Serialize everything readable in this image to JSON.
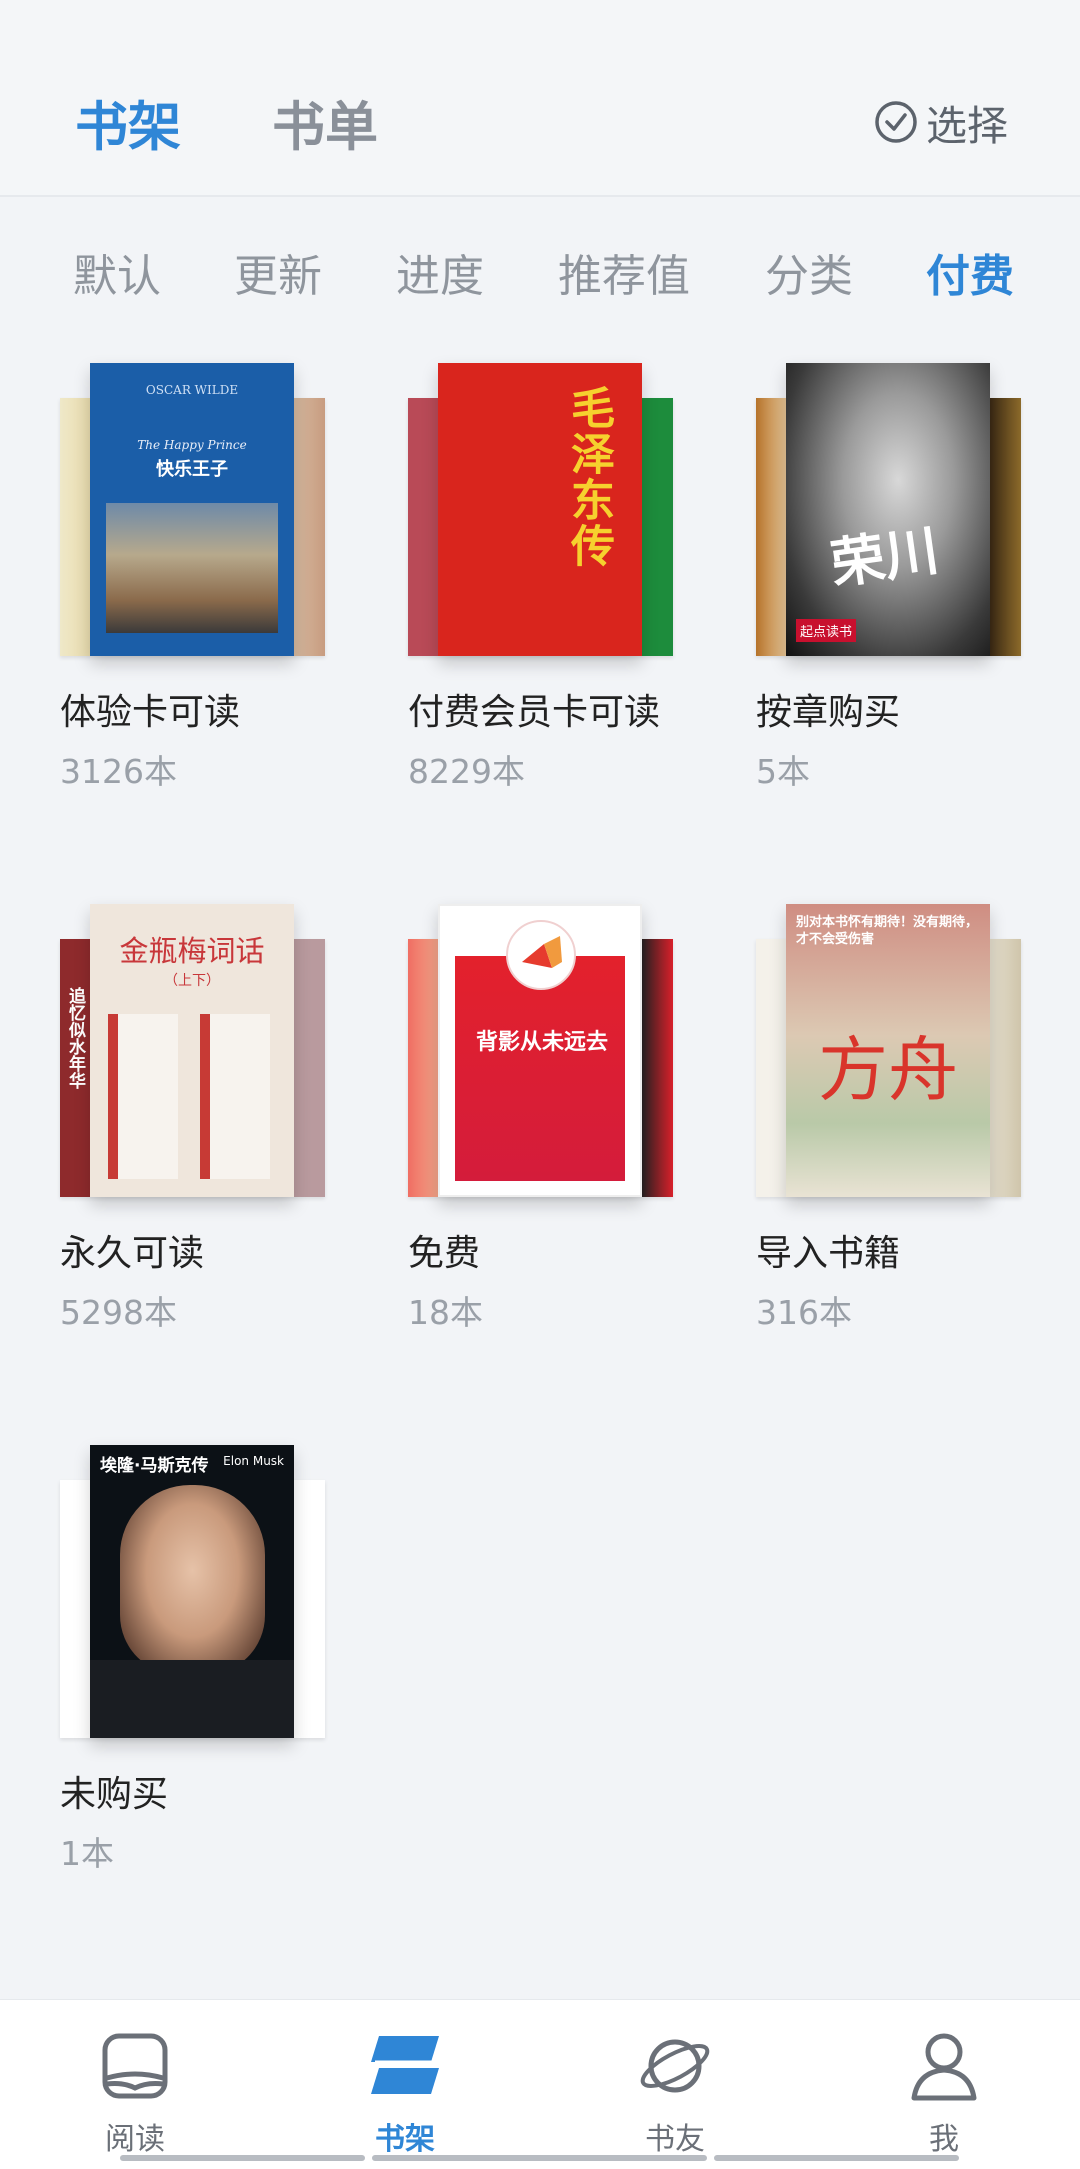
{
  "header": {
    "tabs": [
      {
        "label": "书架",
        "active": true
      },
      {
        "label": "书单",
        "active": false
      }
    ],
    "select_label": "选择"
  },
  "sort_options": [
    {
      "label": "默认",
      "active": false
    },
    {
      "label": "更新",
      "active": false
    },
    {
      "label": "进度",
      "active": false
    },
    {
      "label": "推荐值",
      "active": false
    },
    {
      "label": "分类",
      "active": false
    },
    {
      "label": "付费",
      "active": true
    }
  ],
  "groups": [
    {
      "title": "体验卡可读",
      "count": "3126本",
      "front_cover": {
        "title": "快乐王子",
        "subtitle": "The Happy Prince",
        "author": "OSCAR WILDE"
      }
    },
    {
      "title": "付费会员卡可读",
      "count": "8229本",
      "front_cover": {
        "title": "毛泽东传"
      }
    },
    {
      "title": "按章购买",
      "count": "5本",
      "front_cover": {
        "title": "荣川",
        "publisher": "起点读书"
      }
    },
    {
      "title": "永久可读",
      "count": "5298本",
      "front_cover": {
        "title": "金瓶梅词话",
        "subtitle": "（上下）"
      },
      "back_cover": {
        "title": "追忆似水年华"
      }
    },
    {
      "title": "免费",
      "count": "18本",
      "front_cover": {
        "title": "背影从未远去"
      }
    },
    {
      "title": "导入书籍",
      "count": "316本",
      "front_cover": {
        "title": "方舟",
        "tagline": "别对本书怀有期待！没有期待，才不会受伤害"
      }
    },
    {
      "title": "未购买",
      "count": "1本",
      "front_cover": {
        "title": "埃隆·马斯克传",
        "subtitle": "Elon Musk"
      }
    }
  ],
  "bottom_nav": [
    {
      "label": "阅读",
      "icon": "book-reader-icon",
      "active": false
    },
    {
      "label": "书架",
      "icon": "bookshelf-icon",
      "active": true
    },
    {
      "label": "书友",
      "icon": "planet-icon",
      "active": false
    },
    {
      "label": "我",
      "icon": "person-icon",
      "active": false
    }
  ],
  "colors": {
    "accent": "#2f86d6",
    "background": "#f2f4f7"
  }
}
